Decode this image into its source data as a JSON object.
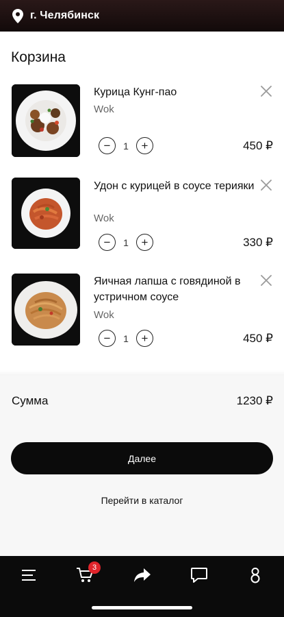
{
  "header": {
    "city": "г. Челябинск",
    "icon": "location-pin-icon"
  },
  "page": {
    "title": "Корзина"
  },
  "cart": {
    "items": [
      {
        "name": "Курица Кунг-пао",
        "category": "Wok",
        "quantity": "1",
        "price": "450 ₽"
      },
      {
        "name": "Удон с курицей в соусе терияки",
        "category": "Wok",
        "quantity": "1",
        "price": "330 ₽"
      },
      {
        "name": "Яичная лапша с говядиной в устричном соусе",
        "category": "Wok",
        "quantity": "1",
        "price": "450 ₽"
      }
    ],
    "minus_label": "−",
    "plus_label": "+"
  },
  "summary": {
    "label": "Сумма",
    "total": "1230 ₽",
    "next_button": "Далее",
    "catalog_link": "Перейти в каталог"
  },
  "bottom_nav": {
    "items": [
      "menu-icon",
      "cart-icon",
      "share-icon",
      "chat-icon",
      "profile-icon"
    ],
    "cart_badge": "3"
  },
  "colors": {
    "accent": "#0b0b0b",
    "badge": "#e0242b",
    "summary_bg": "#f7f7f7"
  }
}
